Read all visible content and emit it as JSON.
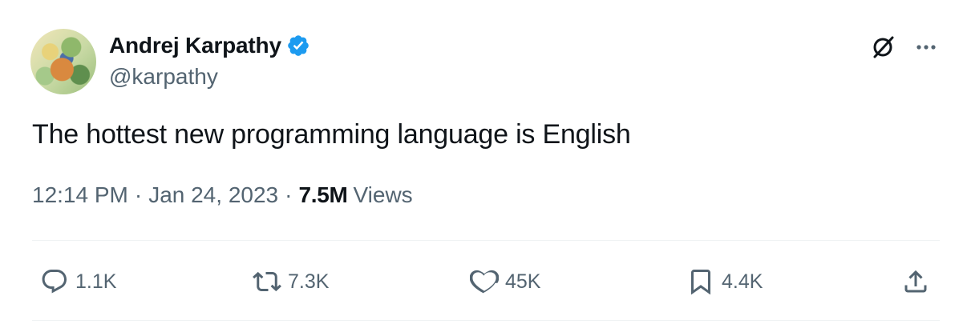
{
  "author": {
    "display_name": "Andrej Karpathy",
    "handle": "@karpathy",
    "verified_color": "#1d9bf0"
  },
  "tweet": {
    "text": "The hottest new programming language is English",
    "time": "12:14 PM",
    "date": "Jan 24, 2023",
    "views_count": "7.5M",
    "views_label": "Views"
  },
  "actions": {
    "replies": "1.1K",
    "retweets": "7.3K",
    "likes": "45K",
    "bookmarks": "4.4K"
  },
  "icons": [
    "verified-badge-icon",
    "grok-icon",
    "more-icon",
    "reply-icon",
    "retweet-icon",
    "like-icon",
    "bookmark-icon",
    "share-icon"
  ],
  "colors": {
    "text": "#0f1419",
    "secondary": "#536471",
    "verified": "#1d9bf0",
    "divider": "#eff3f4"
  }
}
